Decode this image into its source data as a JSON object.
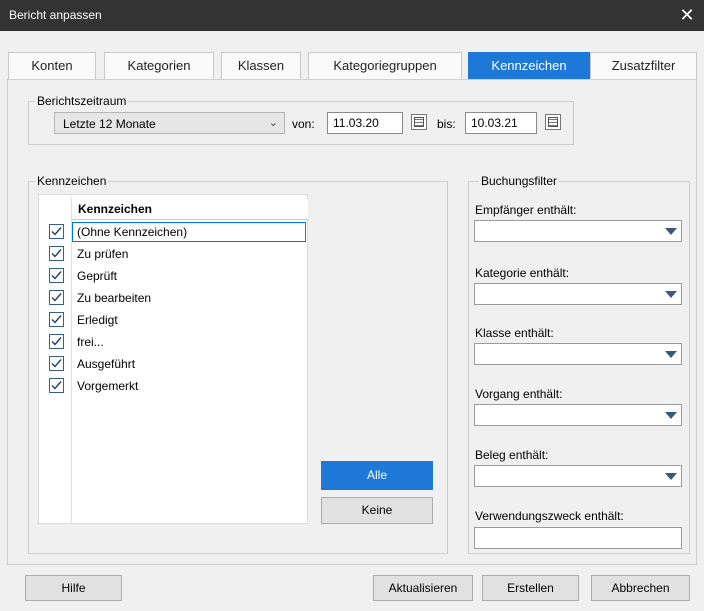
{
  "window": {
    "title": "Bericht anpassen",
    "close_glyph": "✕"
  },
  "tabs": [
    {
      "label": "Konten"
    },
    {
      "label": "Kategorien"
    },
    {
      "label": "Klassen"
    },
    {
      "label": "Kategoriegruppen"
    },
    {
      "label": "Kennzeichen",
      "active": true
    },
    {
      "label": "Zusatzfilter"
    }
  ],
  "period": {
    "group_label": "Berichtszeitraum",
    "range_value": "Letzte 12 Monate",
    "from_label": "von:",
    "from_value": "11.03.20",
    "to_label": "bis:",
    "to_value": "10.03.21"
  },
  "flags": {
    "group_label": "Kennzeichen",
    "column_header": "Kennzeichen",
    "items": [
      {
        "label": "(Ohne Kennzeichen)",
        "checked": true
      },
      {
        "label": "Zu prüfen",
        "checked": true
      },
      {
        "label": "Geprüft",
        "checked": true
      },
      {
        "label": "Zu bearbeiten",
        "checked": true
      },
      {
        "label": "Erledigt",
        "checked": true
      },
      {
        "label": "frei...",
        "checked": true
      },
      {
        "label": "Ausgeführt",
        "checked": true
      },
      {
        "label": "Vorgemerkt",
        "checked": true
      }
    ],
    "all_button": "Alle",
    "none_button": "Keine"
  },
  "filters": {
    "group_label": "Buchungsfilter",
    "payee_label": "Empfänger enthält:",
    "category_label": "Kategorie enthält:",
    "class_label": "Klasse enthält:",
    "transaction_label": "Vorgang enthält:",
    "receipt_label": "Beleg enthält:",
    "purpose_label": "Verwendungszweck enthält:"
  },
  "footer": {
    "help": "Hilfe",
    "refresh": "Aktualisieren",
    "create": "Erstellen",
    "cancel": "Abbrechen"
  },
  "colors": {
    "accent": "#1e78d7",
    "titlebar": "#333333"
  }
}
